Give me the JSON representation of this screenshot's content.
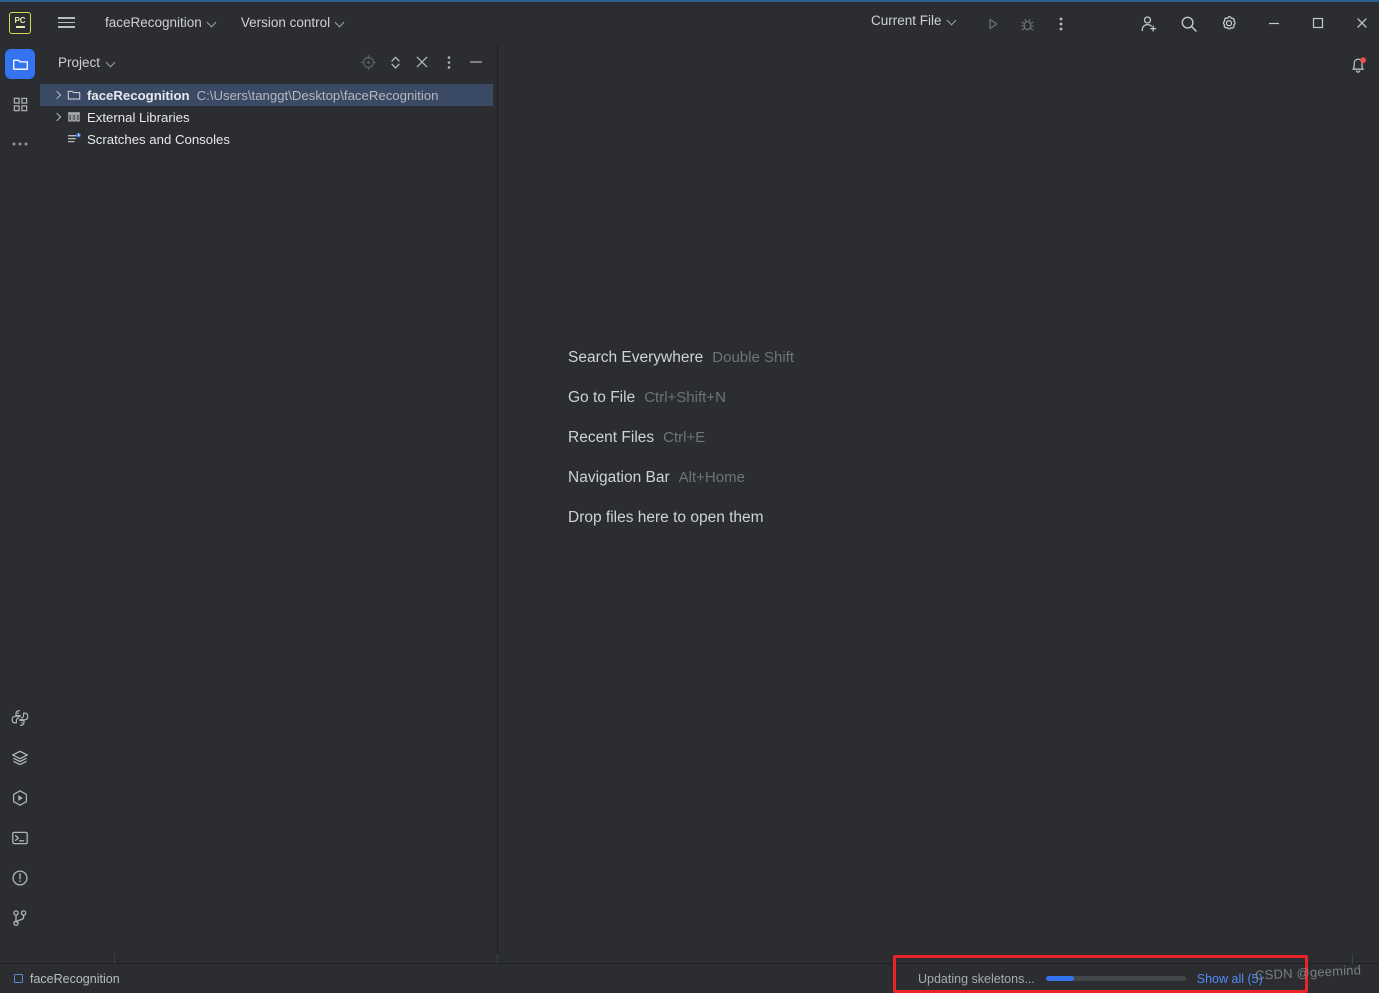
{
  "titlebar": {
    "logo_text": "PC",
    "logo_name": "pycharm-logo",
    "menu_icon": "hamburger-menu-icon",
    "project_menu": "faceRecognition",
    "vcs_menu": "Version control",
    "run_config": "Current File",
    "run_icon": "run-icon",
    "debug_icon": "debug-icon",
    "more_icon": "more-vertical-icon",
    "account_icon": "account-add-icon",
    "search_icon": "search-icon",
    "settings_icon": "gear-icon",
    "minimize_icon": "minimize-icon",
    "maximize_icon": "maximize-icon",
    "close_icon": "close-icon"
  },
  "rail": {
    "top_items": [
      {
        "name": "project-tool-window",
        "icon": "folder-icon",
        "selected": true
      },
      {
        "name": "structure-tool-window",
        "icon": "structure-blocks-icon",
        "selected": false
      },
      {
        "name": "more-tool-windows",
        "icon": "more-horizontal-icon",
        "selected": false
      }
    ],
    "bottom_items": [
      {
        "name": "python-console",
        "icon": "python-icon"
      },
      {
        "name": "services",
        "icon": "layers-icon"
      },
      {
        "name": "run-tool-window",
        "icon": "run-play-hex-icon"
      },
      {
        "name": "terminal",
        "icon": "terminal-icon"
      },
      {
        "name": "problems",
        "icon": "warning-circle-icon"
      },
      {
        "name": "version-control-tool-window",
        "icon": "git-branch-icon"
      }
    ]
  },
  "project_panel": {
    "title": "Project",
    "tools": [
      {
        "name": "select-opened-file",
        "icon": "target-icon",
        "dimmed": true
      },
      {
        "name": "expand-collapse",
        "icon": "expand-collapse-icon",
        "dimmed": false
      },
      {
        "name": "collapse-all",
        "icon": "collapse-all-icon",
        "dimmed": false
      },
      {
        "name": "panel-options",
        "icon": "more-vertical-icon",
        "dimmed": false
      },
      {
        "name": "hide-panel",
        "icon": "minimize-dash-icon",
        "dimmed": false
      }
    ],
    "tree": [
      {
        "label": "faceRecognition",
        "path": "C:\\Users\\tanggt\\Desktop\\faceRecognition",
        "icon": "folder-icon",
        "arrow": true,
        "selected": true,
        "bold": true
      },
      {
        "label": "External Libraries",
        "path": "",
        "icon": "library-icon",
        "arrow": true,
        "selected": false,
        "bold": false
      },
      {
        "label": "Scratches and Consoles",
        "path": "",
        "icon": "scratches-icon",
        "arrow": false,
        "selected": false,
        "bold": false
      }
    ]
  },
  "editor": {
    "hints": [
      {
        "label": "Search Everywhere",
        "key": "Double Shift"
      },
      {
        "label": "Go to File",
        "key": "Ctrl+Shift+N"
      },
      {
        "label": "Recent Files",
        "key": "Ctrl+E"
      },
      {
        "label": "Navigation Bar",
        "key": "Alt+Home"
      }
    ],
    "drop_text": "Drop files here to open them",
    "notification_icon": "bell-icon"
  },
  "statusbar": {
    "project_name": "faceRecognition",
    "project_icon": "project-square-icon",
    "progress_label": "Updating skeletons...",
    "progress_percent": 20,
    "show_all": "Show all (5)",
    "watermark": "CSDN @geemind"
  },
  "colors": {
    "background": "#2b2d30",
    "accent_blue": "#3574f0",
    "selection": "#3b4a64",
    "link": "#548af7",
    "annotation_red": "#e8232a",
    "logo_yellow": "#d6d94a"
  }
}
